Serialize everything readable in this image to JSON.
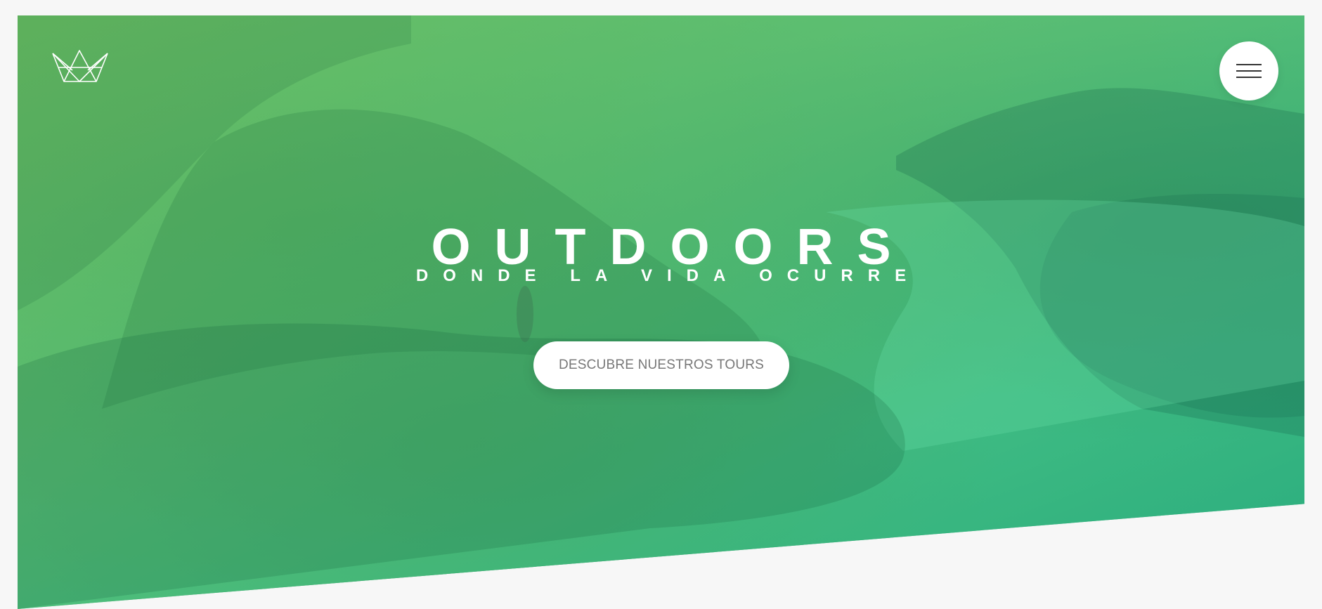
{
  "hero": {
    "title": "OUTDOORS",
    "subtitle": "DONDE LA VIDA OCURRE",
    "cta_label": "DESCUBRE NUESTROS TOURS"
  },
  "logo": {
    "icon": "crown-logo-icon"
  },
  "menu": {
    "icon": "hamburger-menu-icon"
  },
  "colors": {
    "gradient_light": "#7ed56f",
    "gradient_dark": "#28b485",
    "button_background": "#ffffff",
    "button_text": "#777777",
    "page_background": "#f7f7f7"
  }
}
